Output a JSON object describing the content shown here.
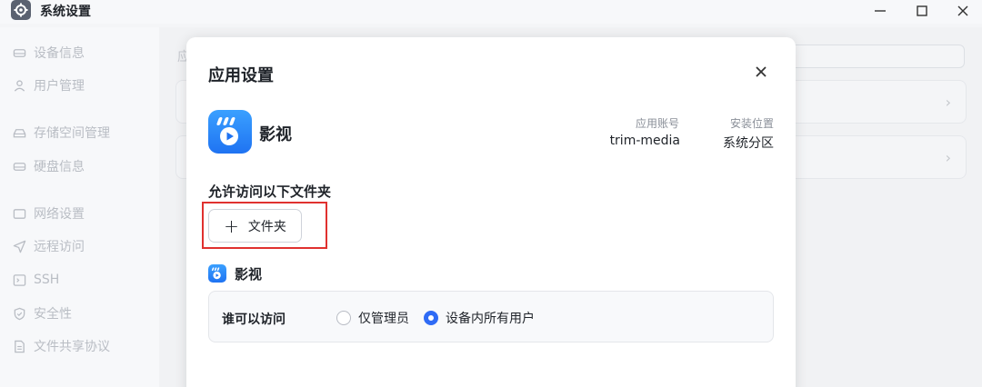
{
  "window": {
    "title": "系统设置",
    "icon": "gear-icon"
  },
  "sidebar": {
    "items": [
      {
        "label": "设备信息",
        "icon": "drive-icon"
      },
      {
        "label": "用户管理",
        "icon": "users-icon"
      },
      {
        "label": "存储空间管理",
        "icon": "storage-icon"
      },
      {
        "label": "硬盘信息",
        "icon": "disk-icon"
      },
      {
        "label": "网络设置",
        "icon": "network-icon"
      },
      {
        "label": "远程访问",
        "icon": "send-icon"
      },
      {
        "label": "SSH",
        "icon": "terminal-icon"
      },
      {
        "label": "安全性",
        "icon": "shield-icon"
      },
      {
        "label": "文件共享协议",
        "icon": "file-icon"
      }
    ]
  },
  "background": {
    "partial_heading": "应"
  },
  "modal": {
    "title": "应用设置",
    "app_name": "影视",
    "account_label": "应用账号",
    "account_value": "trim-media",
    "location_label": "安装位置",
    "location_value": "系统分区",
    "folders_title": "允许访问以下文件夹",
    "add_folder_label": "文件夹",
    "section_app_name": "影视",
    "access_label": "谁可以访问",
    "option_admins": "仅管理员",
    "option_all_users": "设备内所有用户",
    "selected_option": "设备内所有用户"
  },
  "colors": {
    "accent": "#2f6bf5",
    "highlight": "#e0312f",
    "app_logo": "#1f73f2"
  }
}
